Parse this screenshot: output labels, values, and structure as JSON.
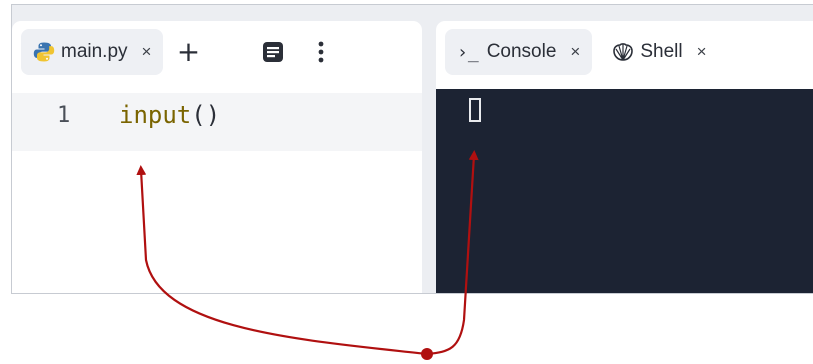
{
  "editor": {
    "tabs": [
      {
        "label": "main.py",
        "close": "×",
        "icon": "python-icon"
      }
    ],
    "add_tab": "+",
    "lines": [
      {
        "number": "1",
        "fn": "input",
        "parens": "()"
      }
    ]
  },
  "console_pane": {
    "tabs": [
      {
        "prefix": "›_",
        "label": "Console",
        "close": "×",
        "icon": "terminal-icon"
      },
      {
        "label": "Shell",
        "close": "×",
        "icon": "shell-icon"
      }
    ]
  },
  "colors": {
    "annotation": "#b01010",
    "console_bg": "#1c2333",
    "code_function": "#7a6400"
  }
}
